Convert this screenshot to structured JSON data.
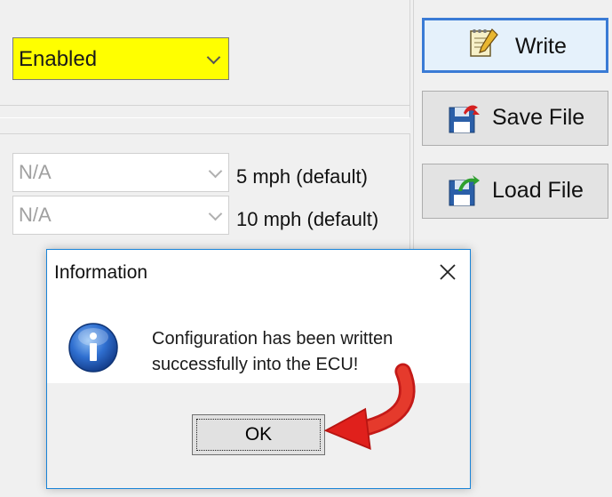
{
  "mode_select": {
    "value": "Enabled"
  },
  "speed_rows": [
    {
      "value": "N/A",
      "label": "5 mph (default)"
    },
    {
      "value": "N/A",
      "label": "10 mph (default)"
    }
  ],
  "actions": {
    "write": "Write",
    "save_file": "Save File",
    "load_file": "Load File"
  },
  "dialog": {
    "title": "Information",
    "message_line1": "Configuration has been written",
    "message_line2": "successfully into the ECU!",
    "ok": "OK",
    "icon": "information-icon"
  },
  "colors": {
    "highlight": "#ffff00",
    "focus_border": "#3a7bd5",
    "arrow": "#e0201c",
    "dialog_border": "#1883d7"
  }
}
